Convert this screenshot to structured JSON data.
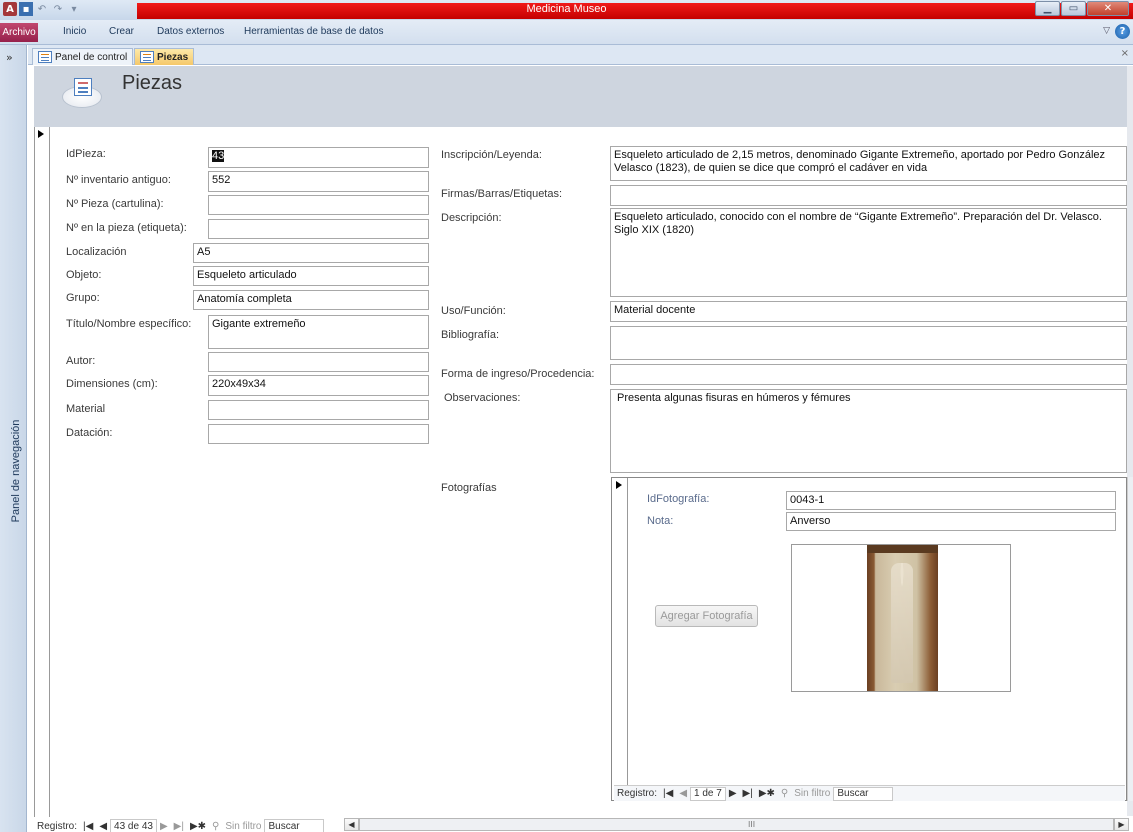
{
  "window": {
    "title": "Medicina Museo",
    "min_glyph": "▁",
    "max_glyph": "▭",
    "close_glyph": "✕"
  },
  "qat": {
    "app_glyph": "A",
    "save_glyph": "▪",
    "undo_glyph": "↶",
    "redo_glyph": "↷",
    "customize_glyph": "▾"
  },
  "ribbon": {
    "file_tab": "Archivo",
    "tabs": [
      "Inicio",
      "Crear",
      "Datos externos",
      "Herramientas de base de datos"
    ],
    "minimize_glyph": "▽",
    "help_glyph": "?"
  },
  "nav_pane": {
    "label": "Panel de navegación",
    "expand_glyph": "»"
  },
  "doc_tabs": [
    {
      "label": "Panel de control",
      "active": false
    },
    {
      "label": "Piezas",
      "active": true
    }
  ],
  "doc_close_glyph": "×",
  "form": {
    "title": "Piezas",
    "left_fields": [
      {
        "label": "IdPieza:",
        "value": "43"
      },
      {
        "label": "Nº inventario antiguo:",
        "value": "552"
      },
      {
        "label": "Nº Pieza (cartulina):",
        "value": ""
      },
      {
        "label": "Nº en la pieza (etiqueta):",
        "value": ""
      },
      {
        "label": "Localización",
        "value": "A5"
      },
      {
        "label": "Objeto:",
        "value": "Esqueleto articulado"
      },
      {
        "label": "Grupo:",
        "value": "Anatomía completa"
      },
      {
        "label": "Título/Nombre específico:",
        "value": "Gigante extremeño"
      },
      {
        "label": "Autor:",
        "value": ""
      },
      {
        "label": "Dimensiones (cm):",
        "value": "220x49x34"
      },
      {
        "label": "Material",
        "value": ""
      },
      {
        "label": "Datación:",
        "value": ""
      }
    ],
    "right_fields": [
      {
        "label": "Inscripción/Leyenda:",
        "value": "Esqueleto articulado de 2,15 metros, denominado Gigante Extremeño, aportado por Pedro González Velasco (1823), de quien se dice que compró el cadáver en vida"
      },
      {
        "label": "Firmas/Barras/Etiquetas:",
        "value": ""
      },
      {
        "label": "Descripción:",
        "value": "Esqueleto articulado, conocido con el nombre de “Gigante Extremeño”. Preparación del Dr. Velasco. Siglo XIX (1820)"
      },
      {
        "label": "Uso/Función:",
        "value": "Material docente"
      },
      {
        "label": "Bibliografía:",
        "value": ""
      },
      {
        "label": "Forma de ingreso/Procedencia:",
        "value": ""
      },
      {
        "label": "Observaciones:",
        "value": "Presenta algunas fisuras en húmeros y fémures"
      }
    ],
    "photos": {
      "label": "Fotografías",
      "id_label": "IdFotografía:",
      "id_value": "0043-1",
      "note_label": "Nota:",
      "note_value": "Anverso",
      "add_button": "Agregar Fotografía",
      "nav": {
        "prefix": "Registro:",
        "counter": "1 de 7",
        "filter": "Sin filtro",
        "search": "Buscar"
      }
    }
  },
  "record_nav": {
    "prefix": "Registro:",
    "counter": "43 de 43",
    "filter": "Sin filtro",
    "search": "Buscar"
  },
  "nav_glyphs": {
    "first": "|◀",
    "prev": "◀",
    "next": "▶",
    "last": "▶|",
    "new": "▶✱",
    "filter_icon": "⚲"
  },
  "scroll_glyphs": {
    "left": "◀",
    "right": "▶",
    "grip": "III"
  }
}
